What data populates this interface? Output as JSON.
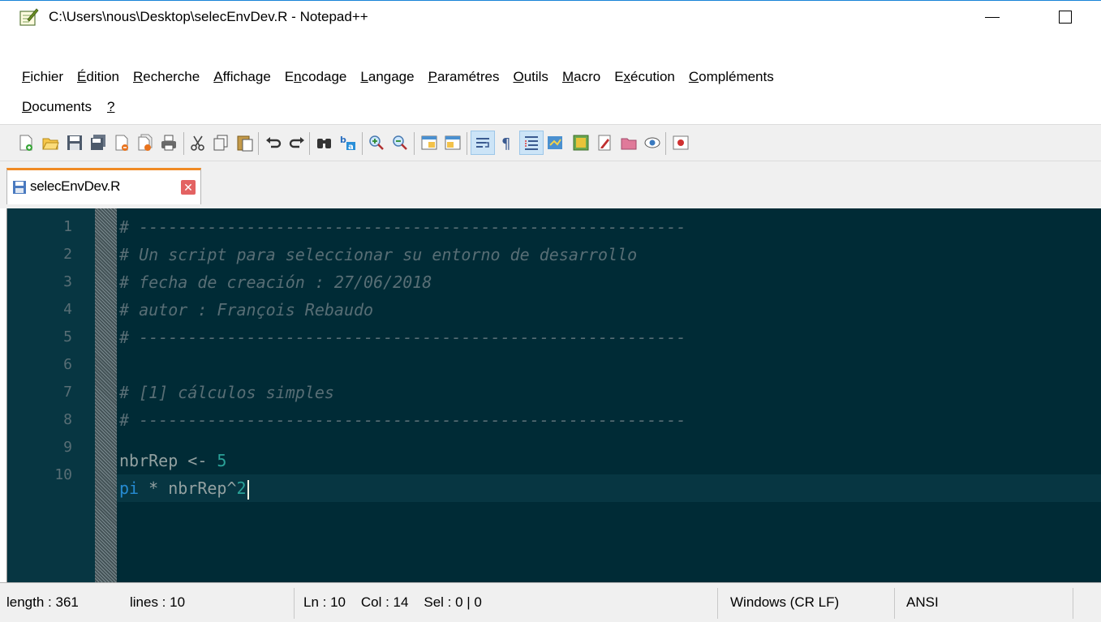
{
  "window": {
    "title": "C:\\Users\\nous\\Desktop\\selecEnvDev.R - Notepad++"
  },
  "menu": {
    "row1": [
      {
        "accel": "F",
        "rest": "ichier"
      },
      {
        "accel": "É",
        "rest": "dition"
      },
      {
        "accel": "R",
        "rest": "echerche"
      },
      {
        "accel": "A",
        "rest": "ffichage"
      },
      {
        "pre": "E",
        "accel": "n",
        "rest": "codage"
      },
      {
        "accel": "L",
        "rest": "angage"
      },
      {
        "accel": "P",
        "rest": "aramétres"
      },
      {
        "accel": "O",
        "rest": "utils"
      },
      {
        "accel": "M",
        "rest": "acro"
      },
      {
        "pre": "E",
        "accel": "x",
        "rest": "écution"
      },
      {
        "accel": "C",
        "rest": "ompléments"
      }
    ],
    "row2": [
      {
        "accel": "D",
        "rest": "ocuments"
      },
      {
        "accel": "?",
        "rest": ""
      }
    ]
  },
  "toolbar": {
    "icons": [
      "new-file-icon",
      "open-file-icon",
      "save-icon",
      "save-all-icon",
      "close-icon",
      "close-all-icon",
      "print-icon",
      "cut-icon",
      "copy-icon",
      "paste-icon",
      "undo-icon",
      "redo-icon",
      "find-icon",
      "replace-icon",
      "zoom-in-icon",
      "zoom-out-icon",
      "sync-vertical-icon",
      "sync-horizontal-icon",
      "word-wrap-icon",
      "show-all-chars-icon",
      "indent-guide-icon",
      "doc-map-icon",
      "function-list-icon",
      "folder-workspace-icon",
      "doc-list-icon",
      "monitoring-icon",
      "record-macro-icon"
    ]
  },
  "tab": {
    "label": "selecEnvDev.R",
    "close": "✕"
  },
  "editor": {
    "line_numbers": [
      "1",
      "2",
      "3",
      "4",
      "5",
      "6",
      "7",
      "8",
      "9",
      "10"
    ],
    "lines": [
      "# --------------------------------------------------------",
      "# Un script para seleccionar su entorno de desarrollo",
      "# fecha de creación : 27/06/2018",
      "# autor : François Rebaudo",
      "# --------------------------------------------------------",
      "",
      "# [1] cálculos simples",
      "# --------------------------------------------------------",
      "nbrRep <- 5",
      "pi * nbrRep^2"
    ],
    "line9": {
      "ident": "nbrRep <- ",
      "num": "5"
    },
    "line10": {
      "kw": "pi",
      "ident": " * nbrRep^",
      "num": "2"
    },
    "colors": {
      "background": "#002b36",
      "comment": "#586e75",
      "number": "#2aa198",
      "keyword": "#268bd2",
      "text": "#93a1a1"
    }
  },
  "status": {
    "length": "length : 361",
    "lines": "lines : 10",
    "position": "Ln : 10    Col : 14    Sel : 0 | 0",
    "eol": "Windows (CR LF)",
    "encoding": "ANSI"
  }
}
